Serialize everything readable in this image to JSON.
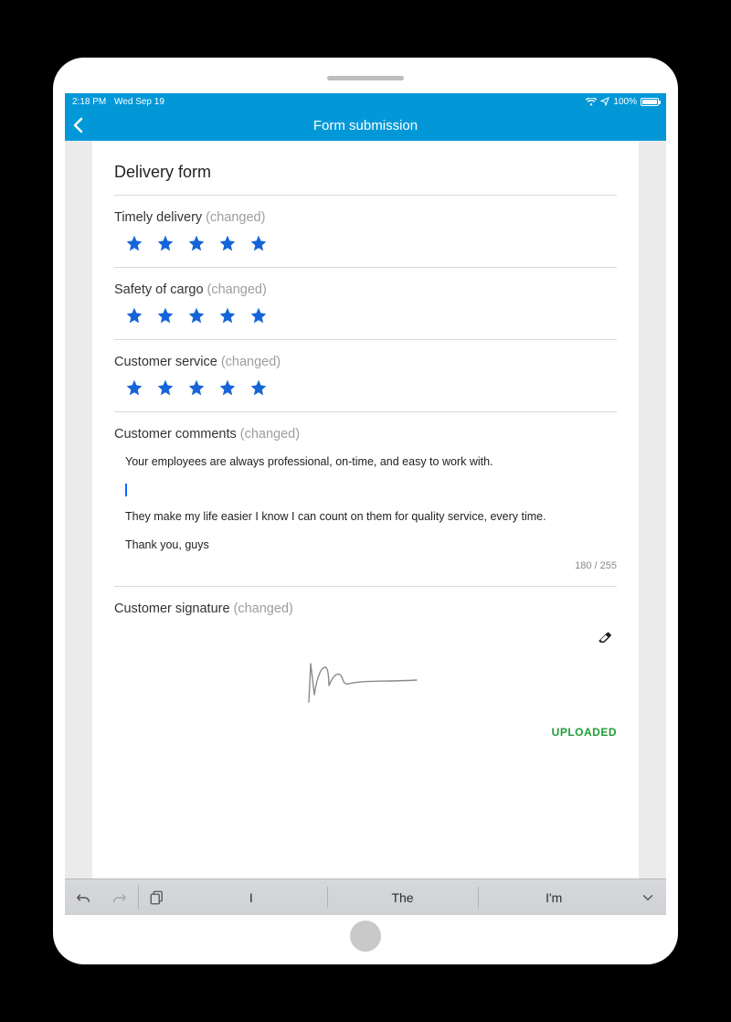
{
  "statusbar": {
    "time": "2:18 PM",
    "date": "Wed Sep 19",
    "battery_pct": "100%"
  },
  "navbar": {
    "title": "Form submission"
  },
  "form": {
    "title": "Delivery form",
    "changed_label": "(changed)",
    "fields": {
      "timely": {
        "label": "Timely delivery",
        "rating": 5
      },
      "safety": {
        "label": "Safety of cargo",
        "rating": 5
      },
      "service": {
        "label": "Customer service",
        "rating": 5
      }
    },
    "comments": {
      "label": "Customer comments",
      "line1": "Your employees are always professional, on-time, and easy to work with.",
      "line2": "They make my life easier I know I can count on them for quality service, every time.",
      "line3": "Thank you, guys",
      "counter": "180 / 255"
    },
    "signature": {
      "label": "Customer signature",
      "status": "UPLOADED"
    }
  },
  "keyboard": {
    "suggestions": [
      "I",
      "The",
      "I'm"
    ]
  },
  "colors": {
    "accent": "#0298d8",
    "star": "#1565d8",
    "uploaded": "#1e9e36"
  }
}
